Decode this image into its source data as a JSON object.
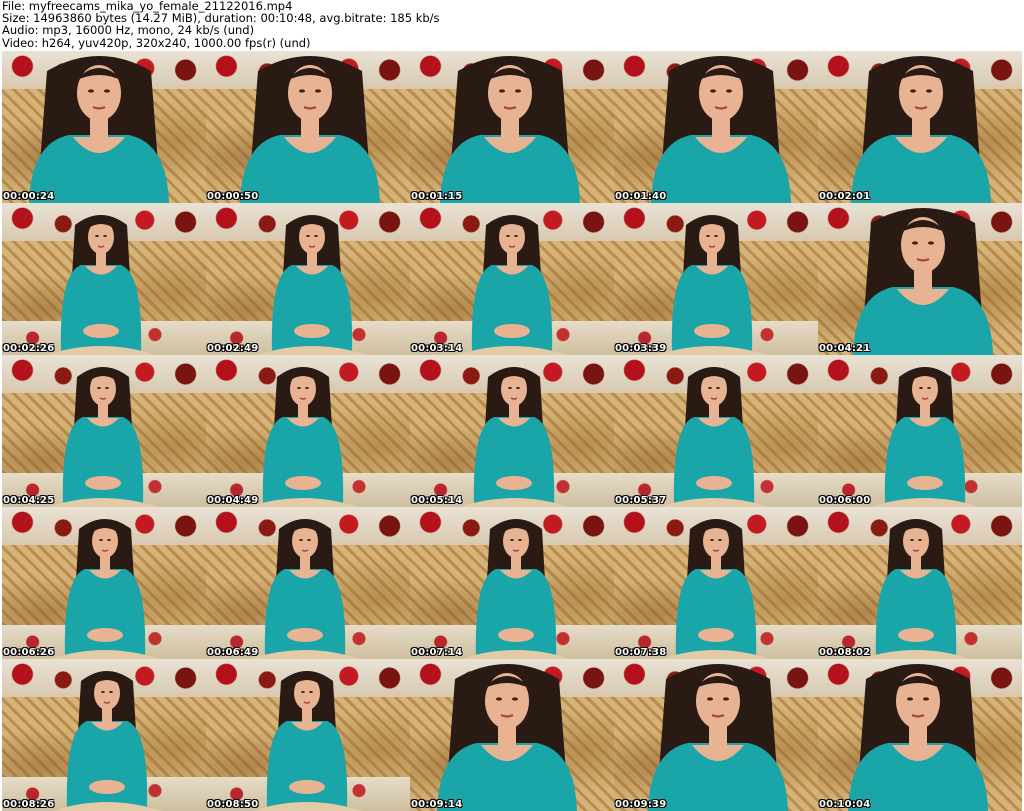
{
  "header": {
    "line1": "File: myfreecams_mika_yo_female_21122016.mp4",
    "line2": "Size: 14963860 bytes (14.27 MiB), duration: 00:10:48, avg.bitrate: 185 kb/s",
    "line3": "Audio: mp3, 16000 Hz, mono, 24 kb/s (und)",
    "line4": "Video: h264, yuv420p, 320x240, 1000.00 fps(r) (und)"
  },
  "colors": {
    "dress": "#1aa6a8",
    "hair": "#2a1a14",
    "skin": "#e7b393",
    "couch": "#c9a46a",
    "accent_red": "#b3121b"
  },
  "thumbnails": [
    {
      "time": "00:00:24",
      "shot": "close"
    },
    {
      "time": "00:00:50",
      "shot": "close"
    },
    {
      "time": "00:01:15",
      "shot": "close"
    },
    {
      "time": "00:01:40",
      "shot": "close"
    },
    {
      "time": "00:02:01",
      "shot": "close"
    },
    {
      "time": "00:02:26",
      "shot": "wide"
    },
    {
      "time": "00:02:49",
      "shot": "wide"
    },
    {
      "time": "00:03:14",
      "shot": "wide"
    },
    {
      "time": "00:03:39",
      "shot": "wide"
    },
    {
      "time": "00:04:21",
      "shot": "close"
    },
    {
      "time": "00:04:25",
      "shot": "wide"
    },
    {
      "time": "00:04:49",
      "shot": "wide"
    },
    {
      "time": "00:05:14",
      "shot": "wide"
    },
    {
      "time": "00:05:37",
      "shot": "wide"
    },
    {
      "time": "00:06:00",
      "shot": "wide"
    },
    {
      "time": "00:06:26",
      "shot": "wide"
    },
    {
      "time": "00:06:49",
      "shot": "wide"
    },
    {
      "time": "00:07:14",
      "shot": "wide"
    },
    {
      "time": "00:07:38",
      "shot": "wide"
    },
    {
      "time": "00:08:02",
      "shot": "wide"
    },
    {
      "time": "00:08:26",
      "shot": "wide"
    },
    {
      "time": "00:08:50",
      "shot": "wide"
    },
    {
      "time": "00:09:14",
      "shot": "close"
    },
    {
      "time": "00:09:39",
      "shot": "close"
    },
    {
      "time": "00:10:04",
      "shot": "close"
    }
  ]
}
